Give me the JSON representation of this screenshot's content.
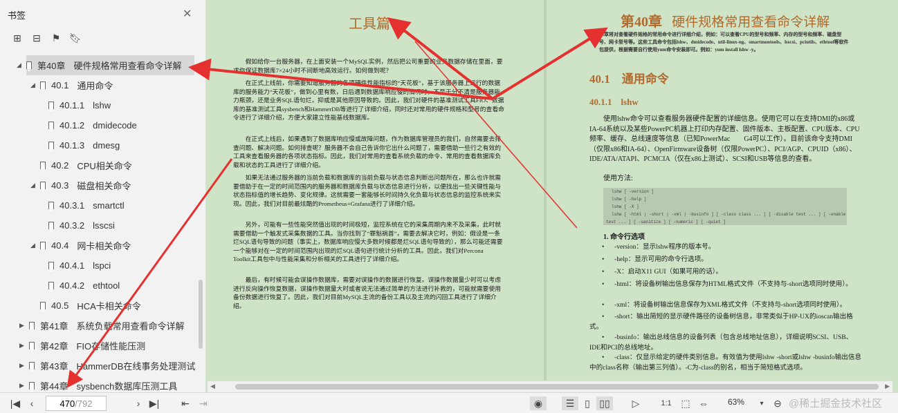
{
  "sidebar": {
    "title": "书签",
    "close_icon": "close-icon",
    "tools": [
      "expand-all-icon",
      "collapse-all-icon",
      "add-bookmark-icon",
      "bookmark-icon"
    ],
    "items": [
      {
        "num": "第40章",
        "label": "硬件规格常用查看命令详解",
        "level": 0,
        "expanded": true,
        "selected": true
      },
      {
        "num": "40.1",
        "label": "通用命令",
        "level": 1,
        "expanded": true
      },
      {
        "num": "40.1.1",
        "label": "lshw",
        "level": 2
      },
      {
        "num": "40.1.2",
        "label": "dmidecode",
        "level": 2
      },
      {
        "num": "40.1.3",
        "label": "dmesg",
        "level": 2
      },
      {
        "num": "40.2",
        "label": "CPU相关命令",
        "level": 1
      },
      {
        "num": "40.3",
        "label": "磁盘相关命令",
        "level": 1,
        "expanded": true
      },
      {
        "num": "40.3.1",
        "label": "smartctl",
        "level": 2
      },
      {
        "num": "40.3.2",
        "label": "lsscsi",
        "level": 2
      },
      {
        "num": "40.4",
        "label": "网卡相关命令",
        "level": 1,
        "expanded": true
      },
      {
        "num": "40.4.1",
        "label": "lspci",
        "level": 2
      },
      {
        "num": "40.4.2",
        "label": "ethtool",
        "level": 2
      },
      {
        "num": "40.5",
        "label": "HCA卡相关命令",
        "level": 1
      },
      {
        "num": "第41章",
        "label": "系统负载常用查看命令详解",
        "level": 0,
        "collapsed": true
      },
      {
        "num": "第42章",
        "label": "FIO存储性能压测",
        "level": 0,
        "collapsed": true
      },
      {
        "num": "第43章",
        "label": "HammerDB在线事务处理测试",
        "level": 0,
        "collapsed": true
      },
      {
        "num": "第44章",
        "label": "sysbench数据库压测工具",
        "level": 0,
        "collapsed": true
      }
    ]
  },
  "left_page": {
    "title": "工具篇",
    "paragraphs": [
      "假如给你一台服务器，在上面安装一个MySQL实例，然后把公司重要的业务数据存储在里面，要求你保证数据库7×24小时不间断地高效运行。如何做到呢？",
      "在正式上线前，你需要知道服务器的各项硬件性能指标的“天花板”，基于该服务器上运行的数据库的服务能力“天花板”，做到心里有数，日后遇到数据库响应慢的情况时，不至于分不清是服务器能力瓶颈，还是业务SQL语句烂，抑或是其他原因导致的。因此，我们对硬件的基准测试工具FIO、数据库的基准测试工具sysbench和HammerDB等进行了详细介绍，同时还对常用的硬件规格和型号的查看命令进行了详细介绍，方便大家建立性能基线数据库。",
      "在正式上线后，如果遇到了数据库响应慢或故障问题，作为数据库管理员的我们，自然需要去排查问题、解决问题。如何排查呢？服务器不会自己告诉你它出什么问题了，需要借助一些行之有效的工具来查看服务器的各项状态指标。因此，我们对常用的查看系统负载的命令、常用的查看数据库负载和状态的工具进行了详细介绍。",
      "如果无法通过服务器的当前负载和数据库的当前负载与状态信息判断出问题所在，那么也许就需要借助于在一定的时间范围内的服务器和数据库负载与状态信息进行分析，以便找出一些关键性能与状态指标值的增长趋势、变化规律。这就需要一套能够长时间持久化负载与状态信息的监控系统来实现。因此，我们对目前最炫酷的Prometheus+Grafana进行了详细介绍。",
      "另外，可能有一些性能突然值出现的时间极短，监控系统在它的采集周期内来不及采集，此时就需要借助一个触发式采集数据的工具。当你找到了“罪魁祸首”，需要去解决它时，例如：假设是一条烂SQL语句导致的问题（事实上，数据库响应慢大多数时候都是烂SQL语句导致的），那么可能还需要一个能够对在一定的时间范围内出现的烂SQL语句进行统计分析的工具。因此，我们对Percona　Toolkit工具包中与性能采集和分析相关的工具进行了详细介绍。",
      "最后，有时候可能会误操作数据库，需要对误操作的数据进行恢复。误操作数据量少时可以考虑进行反向操作恢复数据，误操作数据量大时或者说无法通过简单的方法进行补救的，可能就需要使用备份数据进行恢复了。因此，我们对目前MySQL主流的备份工具以及主流的闪回工具进行了详细介绍。"
    ]
  },
  "right_page": {
    "chapter_num": "第40章",
    "chapter_title": "硬件规格常用查看命令详解",
    "abstract": "本章将对查看硬件规格的常用命令进行详细介绍，例如：可以查看CPU的型号和频率、内存的型号和频率、磁盘型号、网卡型号等。这些工具命令包括lshw、dmidecode、util-linux-ng、smartmontools、lsscsi、pciutils、ethtool等软件包提供，根据需要自行使用yum命令安装即可。例如：yum install lshw -y。",
    "h1": "40.1　通用命令",
    "h2": "40.1.1　lshw",
    "intro": "使用lshw命令可以查看服务器硬件配置的详细信息。使用它可以在支持DMI的x86或IA-64系统以及某些PowerPC机器上打印内存配置、固件版本、主板配置、CPU版本、CPU频率、缓存、总线速度等信息（已知PowerMac　　G4可以工作）。目前该命令支持DMI（仅限x86和IA-64）、OpenFirmware设备树（仅限PowerPC）、PCI/AGP、CPUID（x86）、IDE/ATA/ATAPI、PCMCIA（仅在x86上测试）、SCSI和USB等信息的查看。",
    "usage_label": "使用方法:",
    "code": [
      "lshw [ -version ]",
      "lshw [ -help ]",
      "lshw [ -X ]",
      "lshw [ -html | -short | -xml | -businfo ] [ -class class ... ] [ -disable test ... ] [ -enable",
      "test ... ] [ -sanitize ] [ -numeric ] [ -quiet ]"
    ],
    "options_heading": "1. 命令行选项",
    "options": [
      "-version：显示lshw程序的版本号。",
      "-help：显示可用的命令行选项。",
      "-X：启动X11 GUI（如果可用的话）。",
      "-html：将设备树输出信息保存为HTML格式文件（不支持与-short选项同时使用）。",
      "-xml：将设备树输出信息保存为XML格式文件（不支持与-short选项同时使用）。",
      "-short：输出简短的显示硬件路径的设备树信息，非常类似于HP-UX的ioscan输出格式。",
      "-businfo：输出总线信息的设备列表（包含总线地址信息），详细说明SCSI、USB、IDE和PCI的总线地址。",
      "-class：仅显示给定的硬件类别信息。有效值为使用lshw -short或lshw -businfo输出信息中的class名称（输出第三列值）。-C为-class的别名，相当于简短格式选项。"
    ]
  },
  "toolbar": {
    "page_current": "470",
    "page_total": "/792",
    "zoom": "63%",
    "watermark": "@稀土掘金技术社区"
  },
  "colors": {
    "page_bg": "#cfe3c6",
    "heading": "#b06a2d",
    "arrow": "#e53030"
  }
}
